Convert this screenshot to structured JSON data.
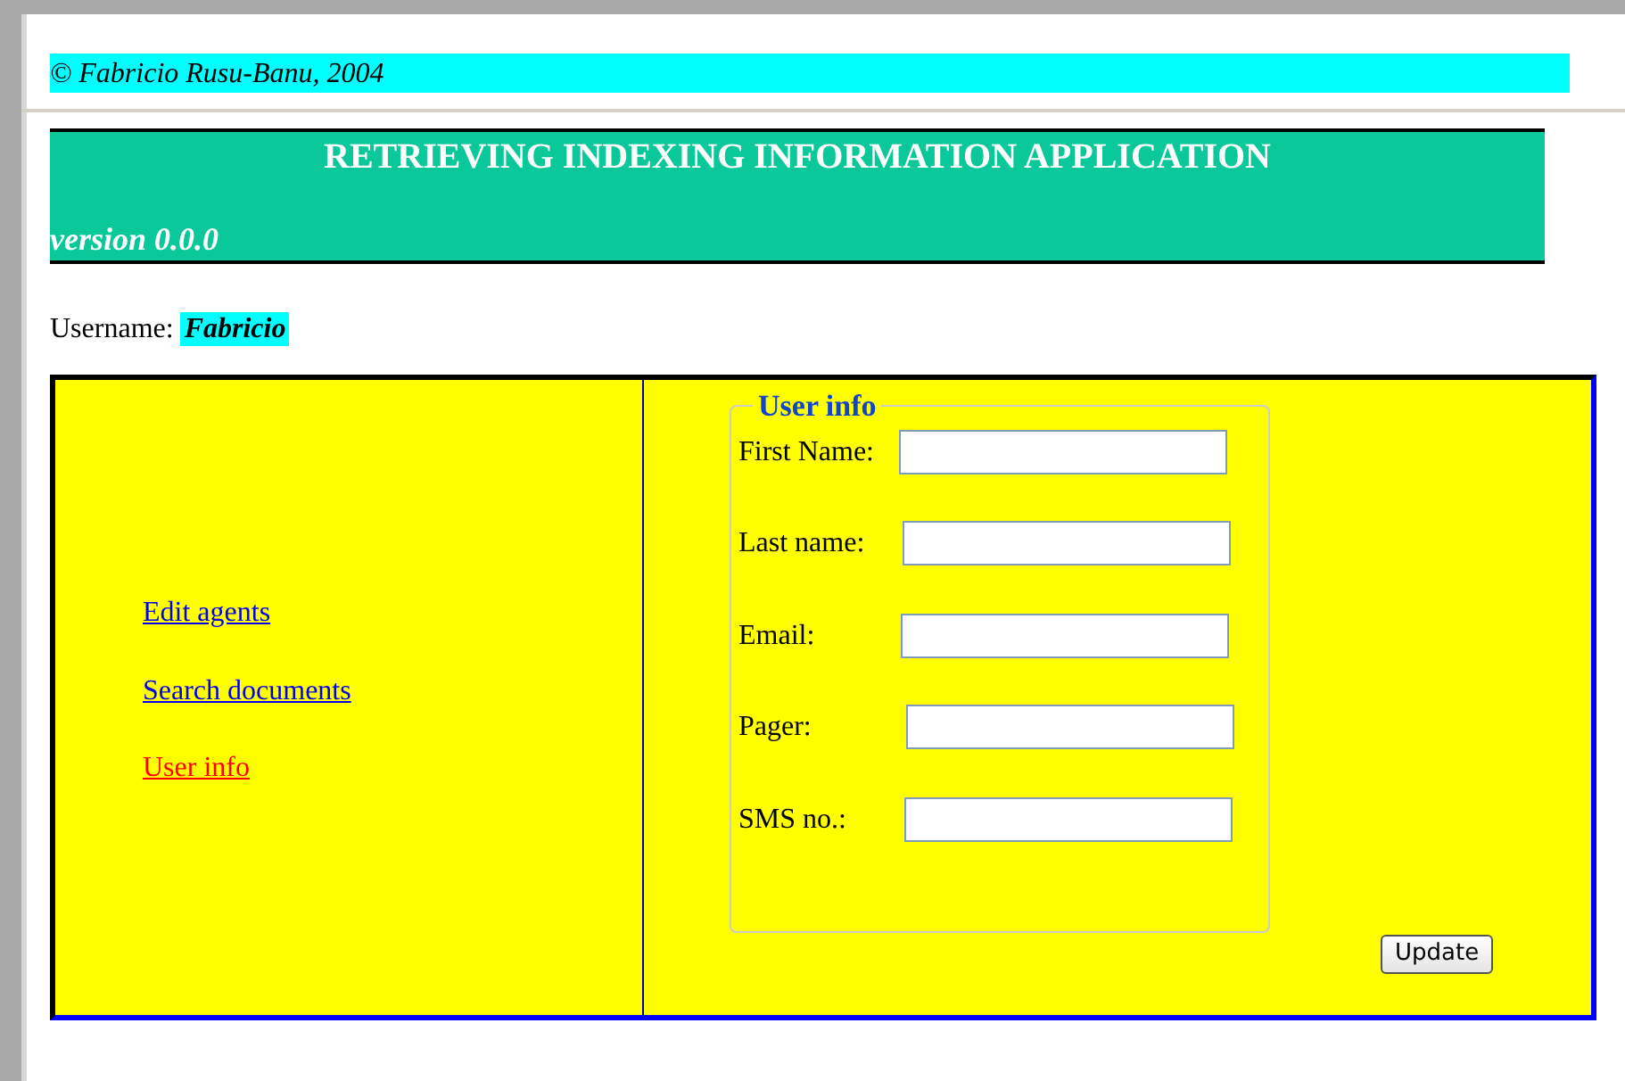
{
  "copyright": "© Fabricio Rusu-Banu, 2004",
  "header": {
    "title": "RETRIEVING INDEXING INFORMATION APPLICATION",
    "version": "version 0.0.0"
  },
  "user": {
    "label": "Username:",
    "name": "Fabricio"
  },
  "nav": [
    {
      "label": "Edit agents",
      "selected": false
    },
    {
      "label": "Search documents",
      "selected": false
    },
    {
      "label": "User info",
      "selected": true
    }
  ],
  "form": {
    "legend": "User info",
    "fields": [
      {
        "label": "First Name:"
      },
      {
        "label": "Last name:"
      },
      {
        "label": "Email:"
      },
      {
        "label": "Pager:"
      },
      {
        "label": "SMS no.:"
      }
    ],
    "button": "Update"
  }
}
